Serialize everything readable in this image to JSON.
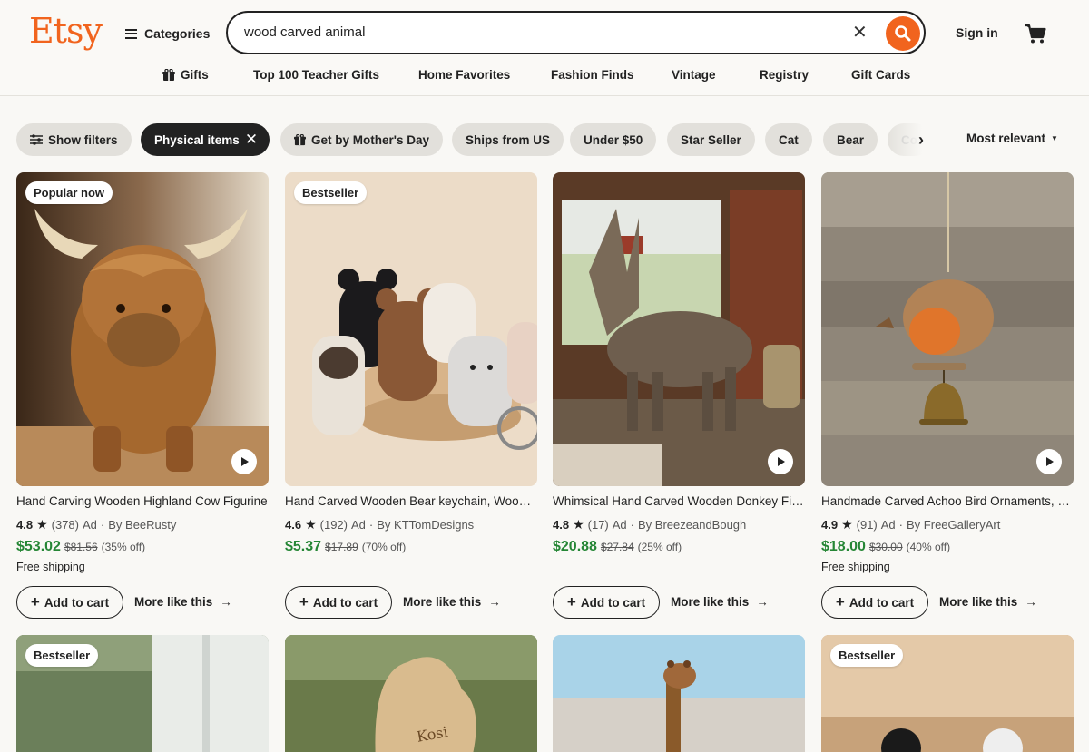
{
  "brand": {
    "logo": "Etsy",
    "accent": "#f1641e"
  },
  "header": {
    "categories_label": "Categories",
    "search_value": "wood carved animal",
    "signin_label": "Sign in",
    "cart_icon": "cart-icon"
  },
  "nav": {
    "gifts": "Gifts",
    "teacher": "Top 100 Teacher Gifts",
    "home": "Home Favorites",
    "fashion": "Fashion Finds",
    "vintage": "Vintage",
    "registry": "Registry",
    "giftcards": "Gift Cards"
  },
  "filters": {
    "show_filters": "Show filters",
    "physical": "Physical items",
    "mothers_day": "Get by Mother's Day",
    "ships_us": "Ships from US",
    "under50": "Under $50",
    "star_seller": "Star Seller",
    "cat": "Cat",
    "bear": "Bear",
    "cut": "Co",
    "sort": "Most relevant"
  },
  "listings": [
    {
      "badge": "Popular now",
      "title": "Hand Carving Wooden Highland Cow Figurine",
      "rating": "4.8",
      "reviews": "(378)",
      "ad": "Ad",
      "shop": "By BeeRusty",
      "price": "$53.02",
      "original": "$81.56",
      "discount": "(35% off)",
      "shipping": "Free shipping",
      "video": true
    },
    {
      "badge": "Bestseller",
      "title": "Hand Carved Wooden Bear keychain, Wooden Animal",
      "rating": "4.6",
      "reviews": "(192)",
      "ad": "Ad",
      "shop": "By KTTomDesigns",
      "price": "$5.37",
      "original": "$17.89",
      "discount": "(70% off)",
      "shipping": "",
      "video": false
    },
    {
      "badge": "",
      "title": "Whimsical Hand Carved Wooden Donkey Figurine",
      "rating": "4.8",
      "reviews": "(17)",
      "ad": "Ad",
      "shop": "By BreezeandBough",
      "price": "$20.88",
      "original": "$27.84",
      "discount": "(25% off)",
      "shipping": "",
      "video": true
    },
    {
      "badge": "",
      "title": "Handmade Carved Achoo Bird Ornaments, Wooden Bell",
      "rating": "4.9",
      "reviews": "(91)",
      "ad": "Ad",
      "shop": "By FreeGalleryArt",
      "price": "$18.00",
      "original": "$30.00",
      "discount": "(40% off)",
      "shipping": "Free shipping",
      "video": true
    }
  ],
  "row2_badges": [
    "Bestseller",
    "",
    "",
    "Bestseller"
  ],
  "kosi_text": "Kosi",
  "card_actions": {
    "add": "Add to cart",
    "more": "More like this"
  }
}
